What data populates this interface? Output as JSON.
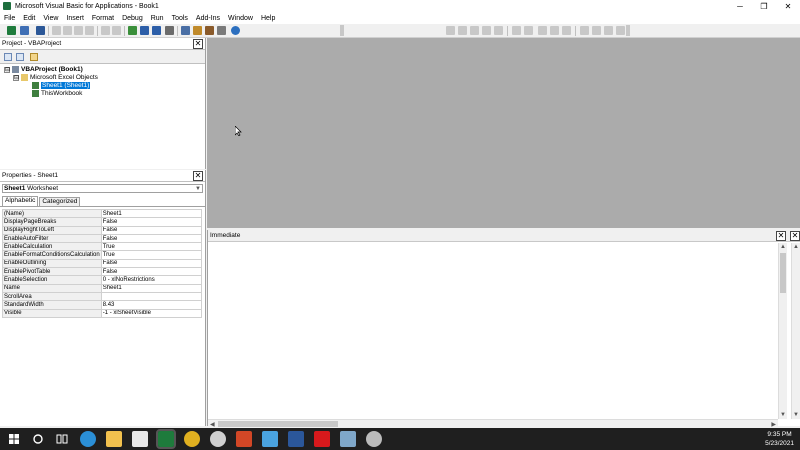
{
  "window": {
    "title": "Microsoft Visual Basic for Applications - Book1",
    "controls": {
      "minimize": "─",
      "restore": "❐",
      "close": "✕"
    }
  },
  "menu": [
    "File",
    "Edit",
    "View",
    "Insert",
    "Format",
    "Debug",
    "Run",
    "Tools",
    "Add-Ins",
    "Window",
    "Help"
  ],
  "project_pane": {
    "title": "Project - VBAProject",
    "close": "✕",
    "tree": {
      "root": "VBAProject (Book1)",
      "folder": "Microsoft Excel Objects",
      "items": [
        "Sheet1 (Sheet1)",
        "ThisWorkbook"
      ],
      "expander_open": "⊟"
    }
  },
  "properties_pane": {
    "title": "Properties - Sheet1",
    "close": "✕",
    "object_name": "Sheet1",
    "object_type": "Worksheet",
    "tabs": [
      "Alphabetic",
      "Categorized"
    ],
    "rows": [
      [
        "(Name)",
        "Sheet1"
      ],
      [
        "DisplayPageBreaks",
        "False"
      ],
      [
        "DisplayRightToLeft",
        "False"
      ],
      [
        "EnableAutoFilter",
        "False"
      ],
      [
        "EnableCalculation",
        "True"
      ],
      [
        "EnableFormatConditionsCalculation",
        "True"
      ],
      [
        "EnableOutlining",
        "False"
      ],
      [
        "EnablePivotTable",
        "False"
      ],
      [
        "EnableSelection",
        "0 - xlNoRestrictions"
      ],
      [
        "Name",
        "Sheet1"
      ],
      [
        "ScrollArea",
        ""
      ],
      [
        "StandardWidth",
        "8.43"
      ],
      [
        "Visible",
        "-1 - xlSheetVisible"
      ]
    ]
  },
  "immediate_pane": {
    "title": "Immediate",
    "close": "✕"
  },
  "taskbar": {
    "time": "9:35 PM",
    "date": "5/23/2021"
  },
  "colors": {
    "workspace": "#ababab",
    "selection": "#0078d7",
    "taskbar": "#1f1f1f"
  }
}
